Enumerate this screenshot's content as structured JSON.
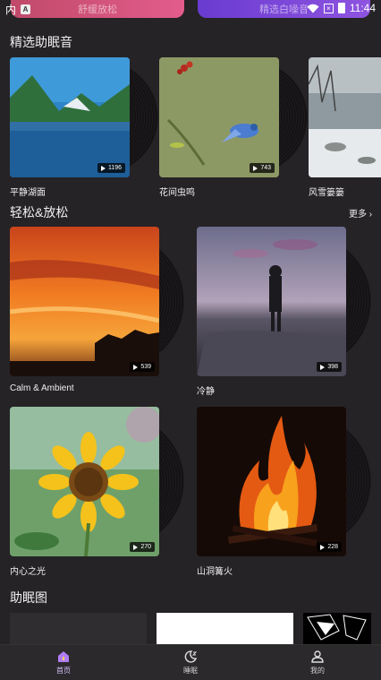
{
  "status_bar": {
    "time": "11:44",
    "left_glyph": "内",
    "left_badge": "A"
  },
  "banners": [
    {
      "label": "舒缓放松"
    },
    {
      "label": "精选白噪音"
    }
  ],
  "featured": {
    "title": "精选助眠音",
    "items": [
      {
        "label": "平静湖面",
        "count": "1196"
      },
      {
        "label": "花间虫鸣",
        "count": "743"
      },
      {
        "label": "风雪篓篓",
        "count": ""
      }
    ]
  },
  "relax": {
    "title": "轻松&放松",
    "more": "更多",
    "items": [
      {
        "label": "Calm & Ambient",
        "count": "539"
      },
      {
        "label": "冷静",
        "count": "398"
      },
      {
        "label": "内心之光",
        "count": "270"
      },
      {
        "label": "山洞篝火",
        "count": "228"
      }
    ]
  },
  "sleep_images": {
    "title": "助眠图"
  },
  "nav": [
    {
      "label": "首页",
      "icon": "home-icon"
    },
    {
      "label": "睡眠",
      "icon": "moon-icon"
    },
    {
      "label": "我的",
      "icon": "profile-icon"
    }
  ],
  "colors": {
    "background": "#252326",
    "active_tab": "#d7c2ff",
    "accent": "#8e54e0"
  }
}
